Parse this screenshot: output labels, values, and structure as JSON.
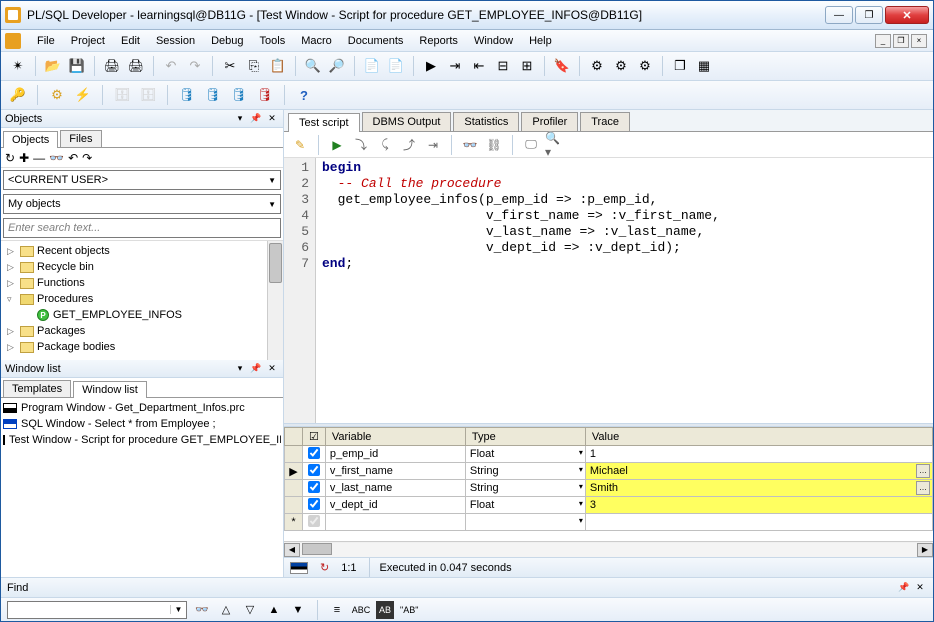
{
  "window": {
    "title": "PL/SQL Developer - learningsql@DB11G - [Test Window - Script for procedure GET_EMPLOYEE_INFOS@DB11G]"
  },
  "menu": [
    "File",
    "Project",
    "Edit",
    "Session",
    "Debug",
    "Tools",
    "Macro",
    "Documents",
    "Reports",
    "Window",
    "Help"
  ],
  "objects": {
    "panel_title": "Objects",
    "tabs": [
      "Objects",
      "Files"
    ],
    "user_combo": "<CURRENT USER>",
    "filter_combo": "My objects",
    "search_placeholder": "Enter search text...",
    "tree": [
      {
        "label": "Recent objects",
        "type": "folder",
        "expand": "▷"
      },
      {
        "label": "Recycle bin",
        "type": "folder",
        "expand": "▷"
      },
      {
        "label": "Functions",
        "type": "folder",
        "expand": "▷"
      },
      {
        "label": "Procedures",
        "type": "folder-open",
        "expand": "▿",
        "children": [
          {
            "label": "GET_EMPLOYEE_INFOS",
            "type": "proc"
          }
        ]
      },
      {
        "label": "Packages",
        "type": "folder",
        "expand": "▷"
      },
      {
        "label": "Package bodies",
        "type": "folder",
        "expand": "▷"
      }
    ]
  },
  "windowlist": {
    "panel_title": "Window list",
    "tabs": [
      "Templates",
      "Window list"
    ],
    "items": [
      {
        "icon": "prog",
        "label": "Program Window - Get_Department_Infos.prc"
      },
      {
        "icon": "sql",
        "label": "SQL Window - Select * from Employee ;"
      },
      {
        "icon": "test",
        "label": "Test Window - Script for procedure GET_EMPLOYEE_INFOS"
      }
    ]
  },
  "editor": {
    "tabs": [
      "Test script",
      "DBMS Output",
      "Statistics",
      "Profiler",
      "Trace"
    ],
    "active_tab": 0,
    "lines": [
      [
        {
          "t": "begin",
          "c": "kw"
        }
      ],
      [
        {
          "t": "  ",
          "c": ""
        },
        {
          "t": "-- Call the procedure",
          "c": "cmt"
        }
      ],
      [
        {
          "t": "  get_employee_infos(p_emp_id => :p_emp_id,",
          "c": "ident"
        }
      ],
      [
        {
          "t": "                     v_first_name => :v_first_name,",
          "c": "ident"
        }
      ],
      [
        {
          "t": "                     v_last_name => :v_last_name,",
          "c": "ident"
        }
      ],
      [
        {
          "t": "                     v_dept_id => :v_dept_id);",
          "c": "ident"
        }
      ],
      [
        {
          "t": "end",
          "c": "kw"
        },
        {
          "t": ";",
          "c": "ident"
        }
      ]
    ]
  },
  "variables": {
    "headers": [
      "Variable",
      "Type",
      "Value"
    ],
    "rows": [
      {
        "checked": true,
        "var": "p_emp_id",
        "type": "Float",
        "value": "1",
        "hl": false,
        "marker": ""
      },
      {
        "checked": true,
        "var": "v_first_name",
        "type": "String",
        "value": "Michael",
        "hl": true,
        "marker": "▶",
        "ell": true
      },
      {
        "checked": true,
        "var": "v_last_name",
        "type": "String",
        "value": "Smith",
        "hl": true,
        "marker": "",
        "ell": true
      },
      {
        "checked": true,
        "var": "v_dept_id",
        "type": "Float",
        "value": "3",
        "hl": true,
        "marker": ""
      }
    ],
    "new_marker": "*"
  },
  "status": {
    "pos": "1:1",
    "msg": "Executed in 0.047 seconds"
  },
  "find": {
    "label": "Find",
    "ab_label": "\"AB\""
  }
}
